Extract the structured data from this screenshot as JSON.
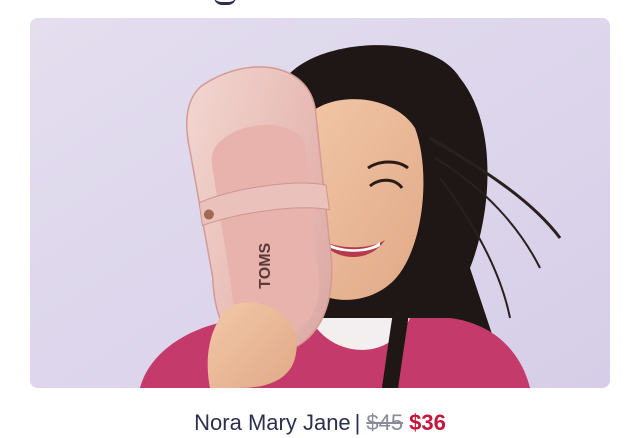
{
  "product": {
    "name": "Nora Mary Jane",
    "separator": "|",
    "original_price": "$45",
    "sale_price": "$36",
    "shoe_brand_text": "TOMS"
  },
  "colors": {
    "background": "#ddd6ee",
    "name_text": "#2d2f4f",
    "original_price": "#8a8a9a",
    "sale_price": "#c4163b",
    "shoe": "#e9c2bd"
  }
}
